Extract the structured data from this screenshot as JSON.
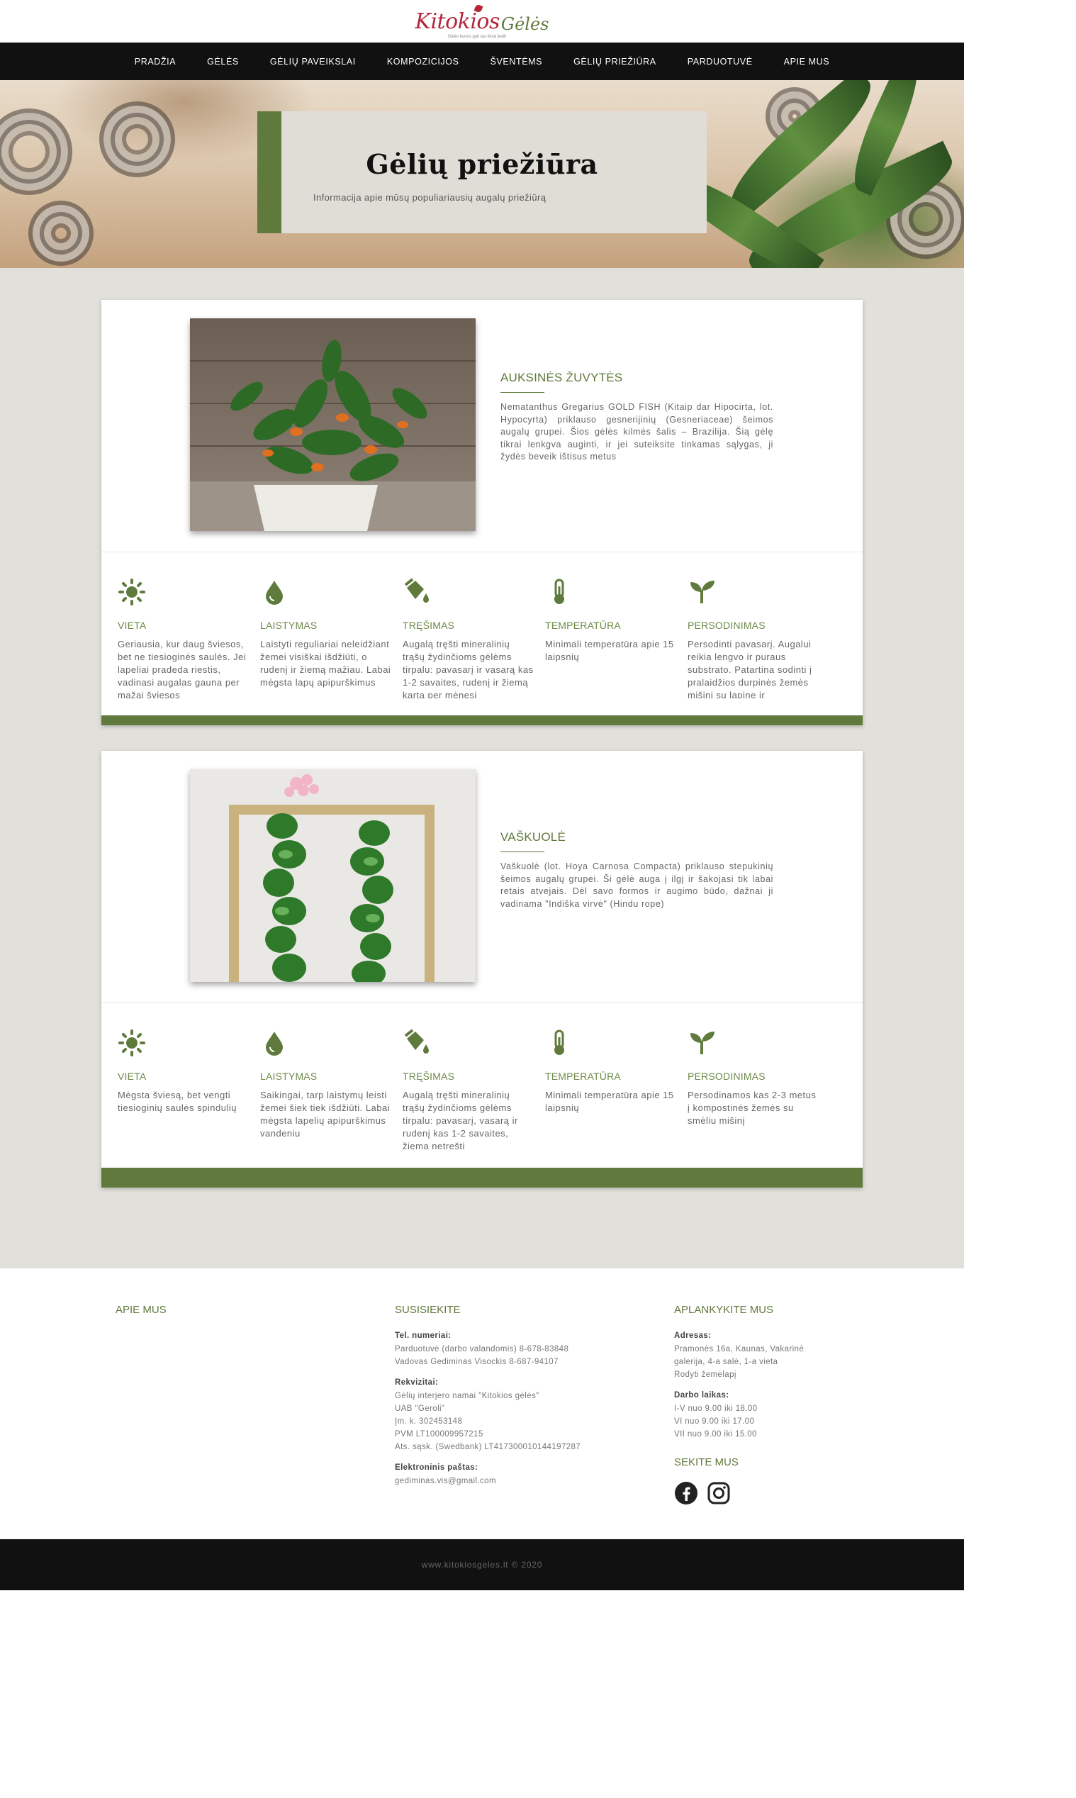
{
  "brand": {
    "name1": "Kitokios",
    "name2": "Gėlės",
    "tagline": "Gėlės kurios gali tau tikrai įkelti"
  },
  "nav": [
    "PRADŽIA",
    "GĖLĖS",
    "GĖLIŲ PAVEIKSLAI",
    "KOMPOZICIJOS",
    "ŠVENTĖMS",
    "GĖLIŲ PRIEŽIŪRA",
    "PARDUOTUVĖ",
    "APIE MUS"
  ],
  "hero": {
    "title": "Gėlių priežiūra",
    "subtitle": "Informacija apie mūsų populiariausių augalų priežiūrą"
  },
  "plants": [
    {
      "title": "AUKSINĖS ŽUVYTĖS",
      "description": "Nematanthus Gregarius GOLD FISH (Kitaip dar Hipocirta, lot. Hypocyrta) priklauso gesnerijinių (Gesneriaceae) šeimos augalų grupei. Šios gėlės kilmės šalis – Brazilija. Šią gėlę tikrai lenkgva auginti, ir jei suteiksite tinkamas sąlygas, ji žydės beveik ištisus metus",
      "care": [
        {
          "icon": "sun-icon",
          "label": "VIETA",
          "text": "Geriausia, kur daug šviesos, bet ne tiesioginės saulės. Jei lapeliai pradeda riestis, vadinasi augalas gauna per mažai šviesos"
        },
        {
          "icon": "water-drop-icon",
          "label": "LAISTYMAS",
          "text": "Laistyti reguliariai neleidžiant žemei visiškai išdžiūti, o rudenį ir žiemą mažiau. Labai mėgsta lapų apipurškimus"
        },
        {
          "icon": "fertilizer-icon",
          "label": "TRĘŠIMAS",
          "text": "Augalą tręšti mineralinių trąšų žydinčioms gėlėms tirpalu: pavasarį ir vasarą kas 1-2 savaites, rudenį ir žiemą kartą per mėnesį"
        },
        {
          "icon": "thermometer-icon",
          "label": "TEMPERATŪRA",
          "text": "Minimali temperatūra apie 15 laipsnių"
        },
        {
          "icon": "sprout-icon",
          "label": "PERSODINIMAS",
          "text": "Persodinti pavasarį. Augalui reikia lengvo ir puraus substrato. Patartina sodinti į pralaidžios durpinės žemės mišinį su lapine ir"
        }
      ]
    },
    {
      "title": "VAŠKUOLĖ",
      "description": "Vaškuolė (lot. Hoya Carnosa Compacta) priklauso stepukinių šeimos augalų grupei. Ši gėlė auga į ilgį ir šakojasi tik labai retais atvejais. Dėl savo formos ir augimo būdo, dažnai ji vadinama \"Indiška virvė\" (Hindu rope)",
      "care": [
        {
          "icon": "sun-icon",
          "label": "VIETA",
          "text": "Mėgsta šviesą, bet vengti tiesioginių saulės spindulių"
        },
        {
          "icon": "water-drop-icon",
          "label": "LAISTYMAS",
          "text": "Saikingai, tarp laistymų leisti žemei šiek tiek išdžiūti. Labai mėgsta lapelių apipurškimus vandeniu"
        },
        {
          "icon": "fertilizer-icon",
          "label": "TRĘŠIMAS",
          "text": "Augalą tręšti mineralinių trąšų žydinčioms gėlėms tirpalu: pavasarį, vasarą ir rudenį kas 1-2 savaites, žiemą netręšti"
        },
        {
          "icon": "thermometer-icon",
          "label": "TEMPERATŪRA",
          "text": "Minimali temperatūra apie 15 laipsnių"
        },
        {
          "icon": "sprout-icon",
          "label": "PERSODINIMAS",
          "text": "Persodinamos kas 2-3 metus į kompostinės žemės su smėliu mišinį"
        }
      ]
    }
  ],
  "footer": {
    "about": {
      "title": "APIE MUS"
    },
    "contact": {
      "title": "SUSISIEKITE",
      "phones_label": "Tel. numeriai:",
      "phones": "Parduotuvė (darbo valandomis) 8-678-83848\nVadovas Gediminas Visockis 8-687-94107",
      "details_label": "Rekvizitai:",
      "details": "Gėlių interjero namai \"Kitokios gėlės\"\nUAB \"Geroli\"\nĮm. k. 302453148\nPVM LT100009957215\nAts. sąsk. (Swedbank) LT417300010144197287",
      "email_label": "Elektroninis paštas:",
      "email": "gediminas.vis@gmail.com"
    },
    "visit": {
      "title": "APLANKYKITE MUS",
      "address_label": "Adresas:",
      "address": "Pramonės 16a, Kaunas, Vakarinė galerija, 4-a salė, 1-a vieta",
      "map_link": "Rodyti žemėlapį",
      "hours_label": "Darbo laikas:",
      "hours": "I-V nuo 9.00 iki 18.00\nVI nuo 9.00 iki 17.00\nVII nuo 9.00 iki 15.00",
      "follow_title": "SEKITE MUS",
      "social": [
        "facebook-icon",
        "instagram-icon"
      ]
    },
    "copyright": "www.kitokiosgeles.lt © 2020"
  },
  "colors": {
    "accent": "#5f7a3c",
    "nav_bg": "#111111",
    "main_bg": "#e2e0da",
    "hero_box": "#e0ddd6",
    "brand_red": "#b3263a"
  }
}
